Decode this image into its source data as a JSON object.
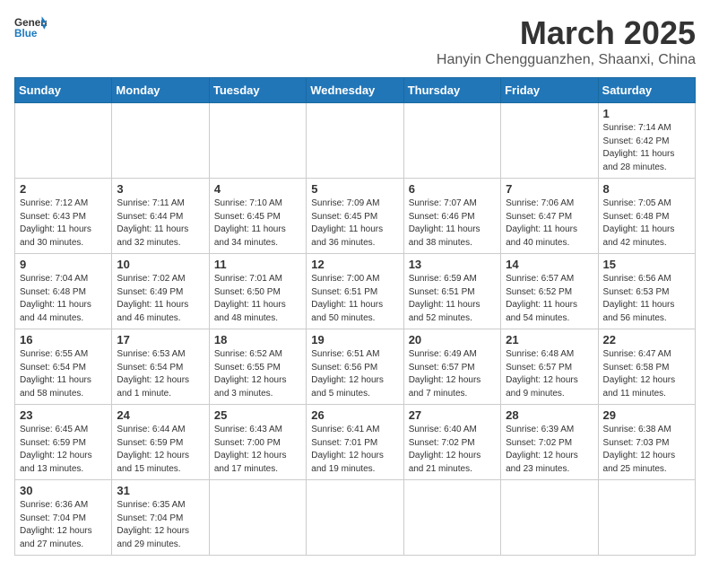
{
  "header": {
    "logo_general": "General",
    "logo_blue": "Blue",
    "month": "March 2025",
    "location": "Hanyin Chengguanzhen, Shaanxi, China"
  },
  "days_of_week": [
    "Sunday",
    "Monday",
    "Tuesday",
    "Wednesday",
    "Thursday",
    "Friday",
    "Saturday"
  ],
  "weeks": [
    [
      {
        "day": "",
        "info": ""
      },
      {
        "day": "",
        "info": ""
      },
      {
        "day": "",
        "info": ""
      },
      {
        "day": "",
        "info": ""
      },
      {
        "day": "",
        "info": ""
      },
      {
        "day": "",
        "info": ""
      },
      {
        "day": "1",
        "info": "Sunrise: 7:14 AM\nSunset: 6:42 PM\nDaylight: 11 hours\nand 28 minutes."
      }
    ],
    [
      {
        "day": "2",
        "info": "Sunrise: 7:12 AM\nSunset: 6:43 PM\nDaylight: 11 hours\nand 30 minutes."
      },
      {
        "day": "3",
        "info": "Sunrise: 7:11 AM\nSunset: 6:44 PM\nDaylight: 11 hours\nand 32 minutes."
      },
      {
        "day": "4",
        "info": "Sunrise: 7:10 AM\nSunset: 6:45 PM\nDaylight: 11 hours\nand 34 minutes."
      },
      {
        "day": "5",
        "info": "Sunrise: 7:09 AM\nSunset: 6:45 PM\nDaylight: 11 hours\nand 36 minutes."
      },
      {
        "day": "6",
        "info": "Sunrise: 7:07 AM\nSunset: 6:46 PM\nDaylight: 11 hours\nand 38 minutes."
      },
      {
        "day": "7",
        "info": "Sunrise: 7:06 AM\nSunset: 6:47 PM\nDaylight: 11 hours\nand 40 minutes."
      },
      {
        "day": "8",
        "info": "Sunrise: 7:05 AM\nSunset: 6:48 PM\nDaylight: 11 hours\nand 42 minutes."
      }
    ],
    [
      {
        "day": "9",
        "info": "Sunrise: 7:04 AM\nSunset: 6:48 PM\nDaylight: 11 hours\nand 44 minutes."
      },
      {
        "day": "10",
        "info": "Sunrise: 7:02 AM\nSunset: 6:49 PM\nDaylight: 11 hours\nand 46 minutes."
      },
      {
        "day": "11",
        "info": "Sunrise: 7:01 AM\nSunset: 6:50 PM\nDaylight: 11 hours\nand 48 minutes."
      },
      {
        "day": "12",
        "info": "Sunrise: 7:00 AM\nSunset: 6:51 PM\nDaylight: 11 hours\nand 50 minutes."
      },
      {
        "day": "13",
        "info": "Sunrise: 6:59 AM\nSunset: 6:51 PM\nDaylight: 11 hours\nand 52 minutes."
      },
      {
        "day": "14",
        "info": "Sunrise: 6:57 AM\nSunset: 6:52 PM\nDaylight: 11 hours\nand 54 minutes."
      },
      {
        "day": "15",
        "info": "Sunrise: 6:56 AM\nSunset: 6:53 PM\nDaylight: 11 hours\nand 56 minutes."
      }
    ],
    [
      {
        "day": "16",
        "info": "Sunrise: 6:55 AM\nSunset: 6:54 PM\nDaylight: 11 hours\nand 58 minutes."
      },
      {
        "day": "17",
        "info": "Sunrise: 6:53 AM\nSunset: 6:54 PM\nDaylight: 12 hours\nand 1 minute."
      },
      {
        "day": "18",
        "info": "Sunrise: 6:52 AM\nSunset: 6:55 PM\nDaylight: 12 hours\nand 3 minutes."
      },
      {
        "day": "19",
        "info": "Sunrise: 6:51 AM\nSunset: 6:56 PM\nDaylight: 12 hours\nand 5 minutes."
      },
      {
        "day": "20",
        "info": "Sunrise: 6:49 AM\nSunset: 6:57 PM\nDaylight: 12 hours\nand 7 minutes."
      },
      {
        "day": "21",
        "info": "Sunrise: 6:48 AM\nSunset: 6:57 PM\nDaylight: 12 hours\nand 9 minutes."
      },
      {
        "day": "22",
        "info": "Sunrise: 6:47 AM\nSunset: 6:58 PM\nDaylight: 12 hours\nand 11 minutes."
      }
    ],
    [
      {
        "day": "23",
        "info": "Sunrise: 6:45 AM\nSunset: 6:59 PM\nDaylight: 12 hours\nand 13 minutes."
      },
      {
        "day": "24",
        "info": "Sunrise: 6:44 AM\nSunset: 6:59 PM\nDaylight: 12 hours\nand 15 minutes."
      },
      {
        "day": "25",
        "info": "Sunrise: 6:43 AM\nSunset: 7:00 PM\nDaylight: 12 hours\nand 17 minutes."
      },
      {
        "day": "26",
        "info": "Sunrise: 6:41 AM\nSunset: 7:01 PM\nDaylight: 12 hours\nand 19 minutes."
      },
      {
        "day": "27",
        "info": "Sunrise: 6:40 AM\nSunset: 7:02 PM\nDaylight: 12 hours\nand 21 minutes."
      },
      {
        "day": "28",
        "info": "Sunrise: 6:39 AM\nSunset: 7:02 PM\nDaylight: 12 hours\nand 23 minutes."
      },
      {
        "day": "29",
        "info": "Sunrise: 6:38 AM\nSunset: 7:03 PM\nDaylight: 12 hours\nand 25 minutes."
      }
    ],
    [
      {
        "day": "30",
        "info": "Sunrise: 6:36 AM\nSunset: 7:04 PM\nDaylight: 12 hours\nand 27 minutes."
      },
      {
        "day": "31",
        "info": "Sunrise: 6:35 AM\nSunset: 7:04 PM\nDaylight: 12 hours\nand 29 minutes."
      },
      {
        "day": "",
        "info": ""
      },
      {
        "day": "",
        "info": ""
      },
      {
        "day": "",
        "info": ""
      },
      {
        "day": "",
        "info": ""
      },
      {
        "day": "",
        "info": ""
      }
    ]
  ]
}
